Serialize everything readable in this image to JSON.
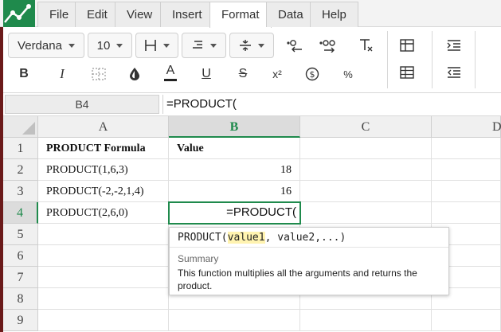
{
  "menu": {
    "items": [
      "File",
      "Edit",
      "View",
      "Insert",
      "Format",
      "Data",
      "Help"
    ],
    "active": "Format"
  },
  "toolbar": {
    "font_family": "Verdana",
    "font_size": "10",
    "percent_label": "%",
    "currency_label": "$",
    "superscript_label": "x²",
    "bold_label": "B",
    "italic_label": "I",
    "underline_label": "U",
    "strike_label": "S",
    "text_color_label": "A",
    "inc_decimals_label": ".00",
    "dec_decimals_label": ".0",
    "clear_format_label": "T"
  },
  "formula_bar": {
    "cell_ref": "B4",
    "content": "=PRODUCT("
  },
  "grid": {
    "columns": [
      "A",
      "B",
      "C",
      "D"
    ],
    "selected_column": "B",
    "rows": [
      "1",
      "2",
      "3",
      "4",
      "5",
      "6",
      "7",
      "8",
      "9"
    ],
    "selected_row": "4",
    "cells": {
      "A1": "PRODUCT Formula",
      "B1": "Value",
      "A2": "PRODUCT(1,6,3)",
      "B2": "18",
      "A3": "PRODUCT(-2,-2,1,4)",
      "B3": "16",
      "A4": "PRODUCT(2,6,0)",
      "B4": "=PRODUCT("
    }
  },
  "autocomplete": {
    "fn_name": "PRODUCT(",
    "arg_highlight": "value1",
    "arg_rest": ", value2,...)",
    "summary_label": "Summary",
    "description": "This function multiplies all the arguments and returns the product."
  },
  "colors": {
    "accent": "#1f8a4c",
    "logo_bg": "#1f8a4c",
    "side_strip": "#6b1a1a"
  }
}
